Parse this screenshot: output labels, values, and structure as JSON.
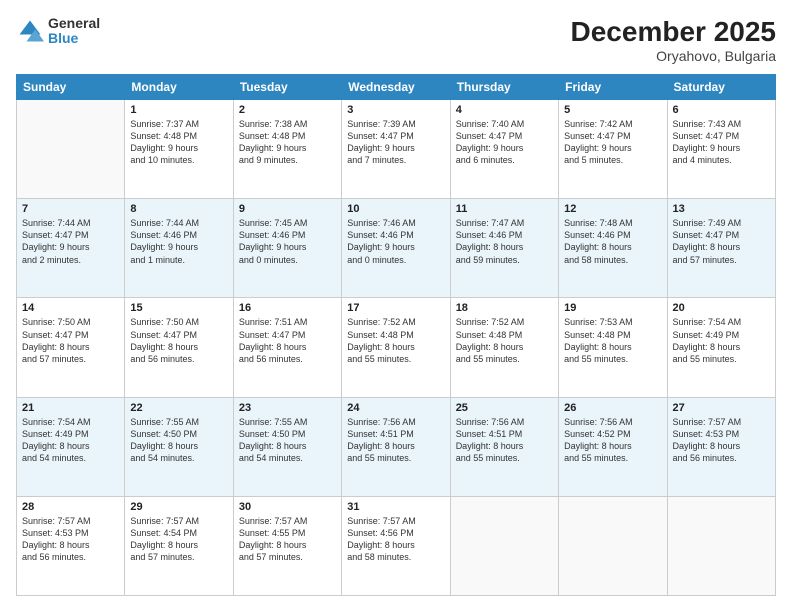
{
  "logo": {
    "general": "General",
    "blue": "Blue"
  },
  "header": {
    "month": "December 2025",
    "location": "Oryahovo, Bulgaria"
  },
  "weekdays": [
    "Sunday",
    "Monday",
    "Tuesday",
    "Wednesday",
    "Thursday",
    "Friday",
    "Saturday"
  ],
  "weeks": [
    [
      {
        "day": "",
        "info": ""
      },
      {
        "day": "1",
        "info": "Sunrise: 7:37 AM\nSunset: 4:48 PM\nDaylight: 9 hours\nand 10 minutes."
      },
      {
        "day": "2",
        "info": "Sunrise: 7:38 AM\nSunset: 4:48 PM\nDaylight: 9 hours\nand 9 minutes."
      },
      {
        "day": "3",
        "info": "Sunrise: 7:39 AM\nSunset: 4:47 PM\nDaylight: 9 hours\nand 7 minutes."
      },
      {
        "day": "4",
        "info": "Sunrise: 7:40 AM\nSunset: 4:47 PM\nDaylight: 9 hours\nand 6 minutes."
      },
      {
        "day": "5",
        "info": "Sunrise: 7:42 AM\nSunset: 4:47 PM\nDaylight: 9 hours\nand 5 minutes."
      },
      {
        "day": "6",
        "info": "Sunrise: 7:43 AM\nSunset: 4:47 PM\nDaylight: 9 hours\nand 4 minutes."
      }
    ],
    [
      {
        "day": "7",
        "info": "Sunrise: 7:44 AM\nSunset: 4:47 PM\nDaylight: 9 hours\nand 2 minutes."
      },
      {
        "day": "8",
        "info": "Sunrise: 7:44 AM\nSunset: 4:46 PM\nDaylight: 9 hours\nand 1 minute."
      },
      {
        "day": "9",
        "info": "Sunrise: 7:45 AM\nSunset: 4:46 PM\nDaylight: 9 hours\nand 0 minutes."
      },
      {
        "day": "10",
        "info": "Sunrise: 7:46 AM\nSunset: 4:46 PM\nDaylight: 9 hours\nand 0 minutes."
      },
      {
        "day": "11",
        "info": "Sunrise: 7:47 AM\nSunset: 4:46 PM\nDaylight: 8 hours\nand 59 minutes."
      },
      {
        "day": "12",
        "info": "Sunrise: 7:48 AM\nSunset: 4:46 PM\nDaylight: 8 hours\nand 58 minutes."
      },
      {
        "day": "13",
        "info": "Sunrise: 7:49 AM\nSunset: 4:47 PM\nDaylight: 8 hours\nand 57 minutes."
      }
    ],
    [
      {
        "day": "14",
        "info": "Sunrise: 7:50 AM\nSunset: 4:47 PM\nDaylight: 8 hours\nand 57 minutes."
      },
      {
        "day": "15",
        "info": "Sunrise: 7:50 AM\nSunset: 4:47 PM\nDaylight: 8 hours\nand 56 minutes."
      },
      {
        "day": "16",
        "info": "Sunrise: 7:51 AM\nSunset: 4:47 PM\nDaylight: 8 hours\nand 56 minutes."
      },
      {
        "day": "17",
        "info": "Sunrise: 7:52 AM\nSunset: 4:48 PM\nDaylight: 8 hours\nand 55 minutes."
      },
      {
        "day": "18",
        "info": "Sunrise: 7:52 AM\nSunset: 4:48 PM\nDaylight: 8 hours\nand 55 minutes."
      },
      {
        "day": "19",
        "info": "Sunrise: 7:53 AM\nSunset: 4:48 PM\nDaylight: 8 hours\nand 55 minutes."
      },
      {
        "day": "20",
        "info": "Sunrise: 7:54 AM\nSunset: 4:49 PM\nDaylight: 8 hours\nand 55 minutes."
      }
    ],
    [
      {
        "day": "21",
        "info": "Sunrise: 7:54 AM\nSunset: 4:49 PM\nDaylight: 8 hours\nand 54 minutes."
      },
      {
        "day": "22",
        "info": "Sunrise: 7:55 AM\nSunset: 4:50 PM\nDaylight: 8 hours\nand 54 minutes."
      },
      {
        "day": "23",
        "info": "Sunrise: 7:55 AM\nSunset: 4:50 PM\nDaylight: 8 hours\nand 54 minutes."
      },
      {
        "day": "24",
        "info": "Sunrise: 7:56 AM\nSunset: 4:51 PM\nDaylight: 8 hours\nand 55 minutes."
      },
      {
        "day": "25",
        "info": "Sunrise: 7:56 AM\nSunset: 4:51 PM\nDaylight: 8 hours\nand 55 minutes."
      },
      {
        "day": "26",
        "info": "Sunrise: 7:56 AM\nSunset: 4:52 PM\nDaylight: 8 hours\nand 55 minutes."
      },
      {
        "day": "27",
        "info": "Sunrise: 7:57 AM\nSunset: 4:53 PM\nDaylight: 8 hours\nand 56 minutes."
      }
    ],
    [
      {
        "day": "28",
        "info": "Sunrise: 7:57 AM\nSunset: 4:53 PM\nDaylight: 8 hours\nand 56 minutes."
      },
      {
        "day": "29",
        "info": "Sunrise: 7:57 AM\nSunset: 4:54 PM\nDaylight: 8 hours\nand 57 minutes."
      },
      {
        "day": "30",
        "info": "Sunrise: 7:57 AM\nSunset: 4:55 PM\nDaylight: 8 hours\nand 57 minutes."
      },
      {
        "day": "31",
        "info": "Sunrise: 7:57 AM\nSunset: 4:56 PM\nDaylight: 8 hours\nand 58 minutes."
      },
      {
        "day": "",
        "info": ""
      },
      {
        "day": "",
        "info": ""
      },
      {
        "day": "",
        "info": ""
      }
    ]
  ]
}
